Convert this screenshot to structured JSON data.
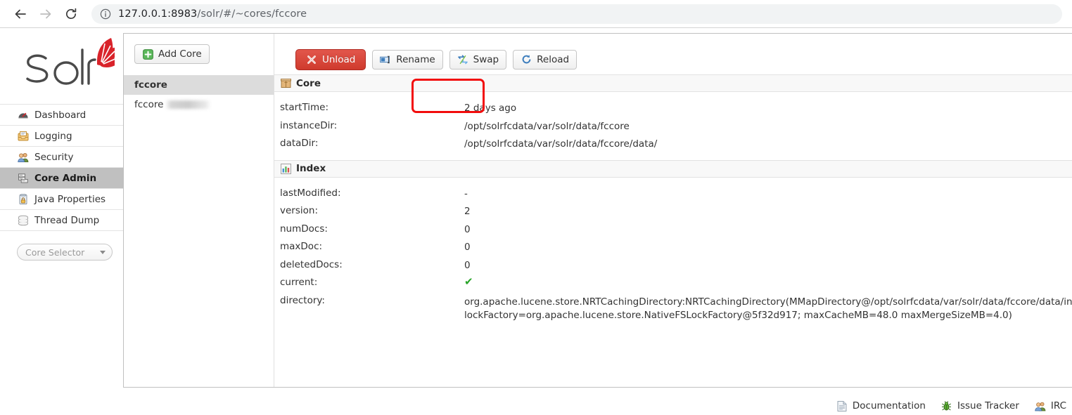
{
  "browser": {
    "back_icon": "back-arrow-icon",
    "forward_icon": "forward-arrow-icon",
    "reload_icon": "reload-icon",
    "info_icon": "info-circle-icon",
    "url_host": "127.0.0.1:8983",
    "url_path": "/solr/#/~cores/fccore",
    "url_full": "127.0.0.1:8983/solr/#/~cores/fccore"
  },
  "sidebar": {
    "logo_text": "Solr",
    "items": [
      {
        "label": "Dashboard",
        "icon": "dashboard-gauge-icon",
        "active": false
      },
      {
        "label": "Logging",
        "icon": "logging-tray-icon",
        "active": false
      },
      {
        "label": "Security",
        "icon": "security-users-icon",
        "active": false
      },
      {
        "label": "Core Admin",
        "icon": "core-admin-server-icon",
        "active": true
      },
      {
        "label": "Java Properties",
        "icon": "java-properties-icon",
        "active": false
      },
      {
        "label": "Thread Dump",
        "icon": "thread-dump-stack-icon",
        "active": false
      }
    ],
    "core_selector": {
      "placeholder": "Core Selector",
      "caret_icon": "chevron-down-icon"
    }
  },
  "core_list": {
    "add_core_label": "Add Core",
    "add_core_icon": "plus-green-icon",
    "entries": [
      {
        "name": "fccore",
        "selected": true,
        "redacted": false
      },
      {
        "name": "fccore",
        "selected": false,
        "redacted": true
      }
    ]
  },
  "toolbar": {
    "unload_label": "Unload",
    "unload_icon": "red-x-icon",
    "rename_label": "Rename",
    "rename_icon": "rename-textbox-icon",
    "swap_label": "Swap",
    "swap_icon": "swap-arrows-icon",
    "reload_label": "Reload",
    "reload_icon": "reload-circular-arrow-icon",
    "highlight_target": "Unload"
  },
  "sections": [
    {
      "title": "Core",
      "icon": "package-box-icon",
      "rows": [
        {
          "key": "startTime:",
          "value": "2 days ago",
          "type": "text"
        },
        {
          "key": "instanceDir:",
          "value": "/opt/solrfcdata/var/solr/data/fccore",
          "type": "text"
        },
        {
          "key": "dataDir:",
          "value": "/opt/solrfcdata/var/solr/data/fccore/data/",
          "type": "text"
        }
      ]
    },
    {
      "title": "Index",
      "icon": "bar-chart-icon",
      "rows": [
        {
          "key": "lastModified:",
          "value": "-",
          "type": "text"
        },
        {
          "key": "version:",
          "value": "2",
          "type": "text"
        },
        {
          "key": "numDocs:",
          "value": "0",
          "type": "text"
        },
        {
          "key": "maxDoc:",
          "value": "0",
          "type": "text"
        },
        {
          "key": "deletedDocs:",
          "value": "0",
          "type": "text"
        },
        {
          "key": "current:",
          "value": "✔",
          "type": "check"
        },
        {
          "key": "directory:",
          "value": "org.apache.lucene.store.NRTCachingDirectory:NRTCachingDirectory(MMapDirectory@/opt/solrfcdata/var/solr/data/fccore/data/index lockFactory=org.apache.lucene.store.NativeFSLockFactory@5f32d917; maxCacheMB=48.0 maxMergeSizeMB=4.0)",
          "type": "text"
        }
      ]
    }
  ],
  "footer": {
    "links": [
      {
        "label": "Documentation",
        "icon": "document-icon"
      },
      {
        "label": "Issue Tracker",
        "icon": "bug-icon"
      },
      {
        "label": "IRC",
        "icon": "people-icon"
      }
    ]
  },
  "colors": {
    "danger": "#cf3a2d",
    "highlight": "#f20d0d",
    "active_menu": "#c0c0c0",
    "selected_row": "#dcdcdc",
    "check_green": "#28a428",
    "solr_logo_red": "#d9232a"
  }
}
